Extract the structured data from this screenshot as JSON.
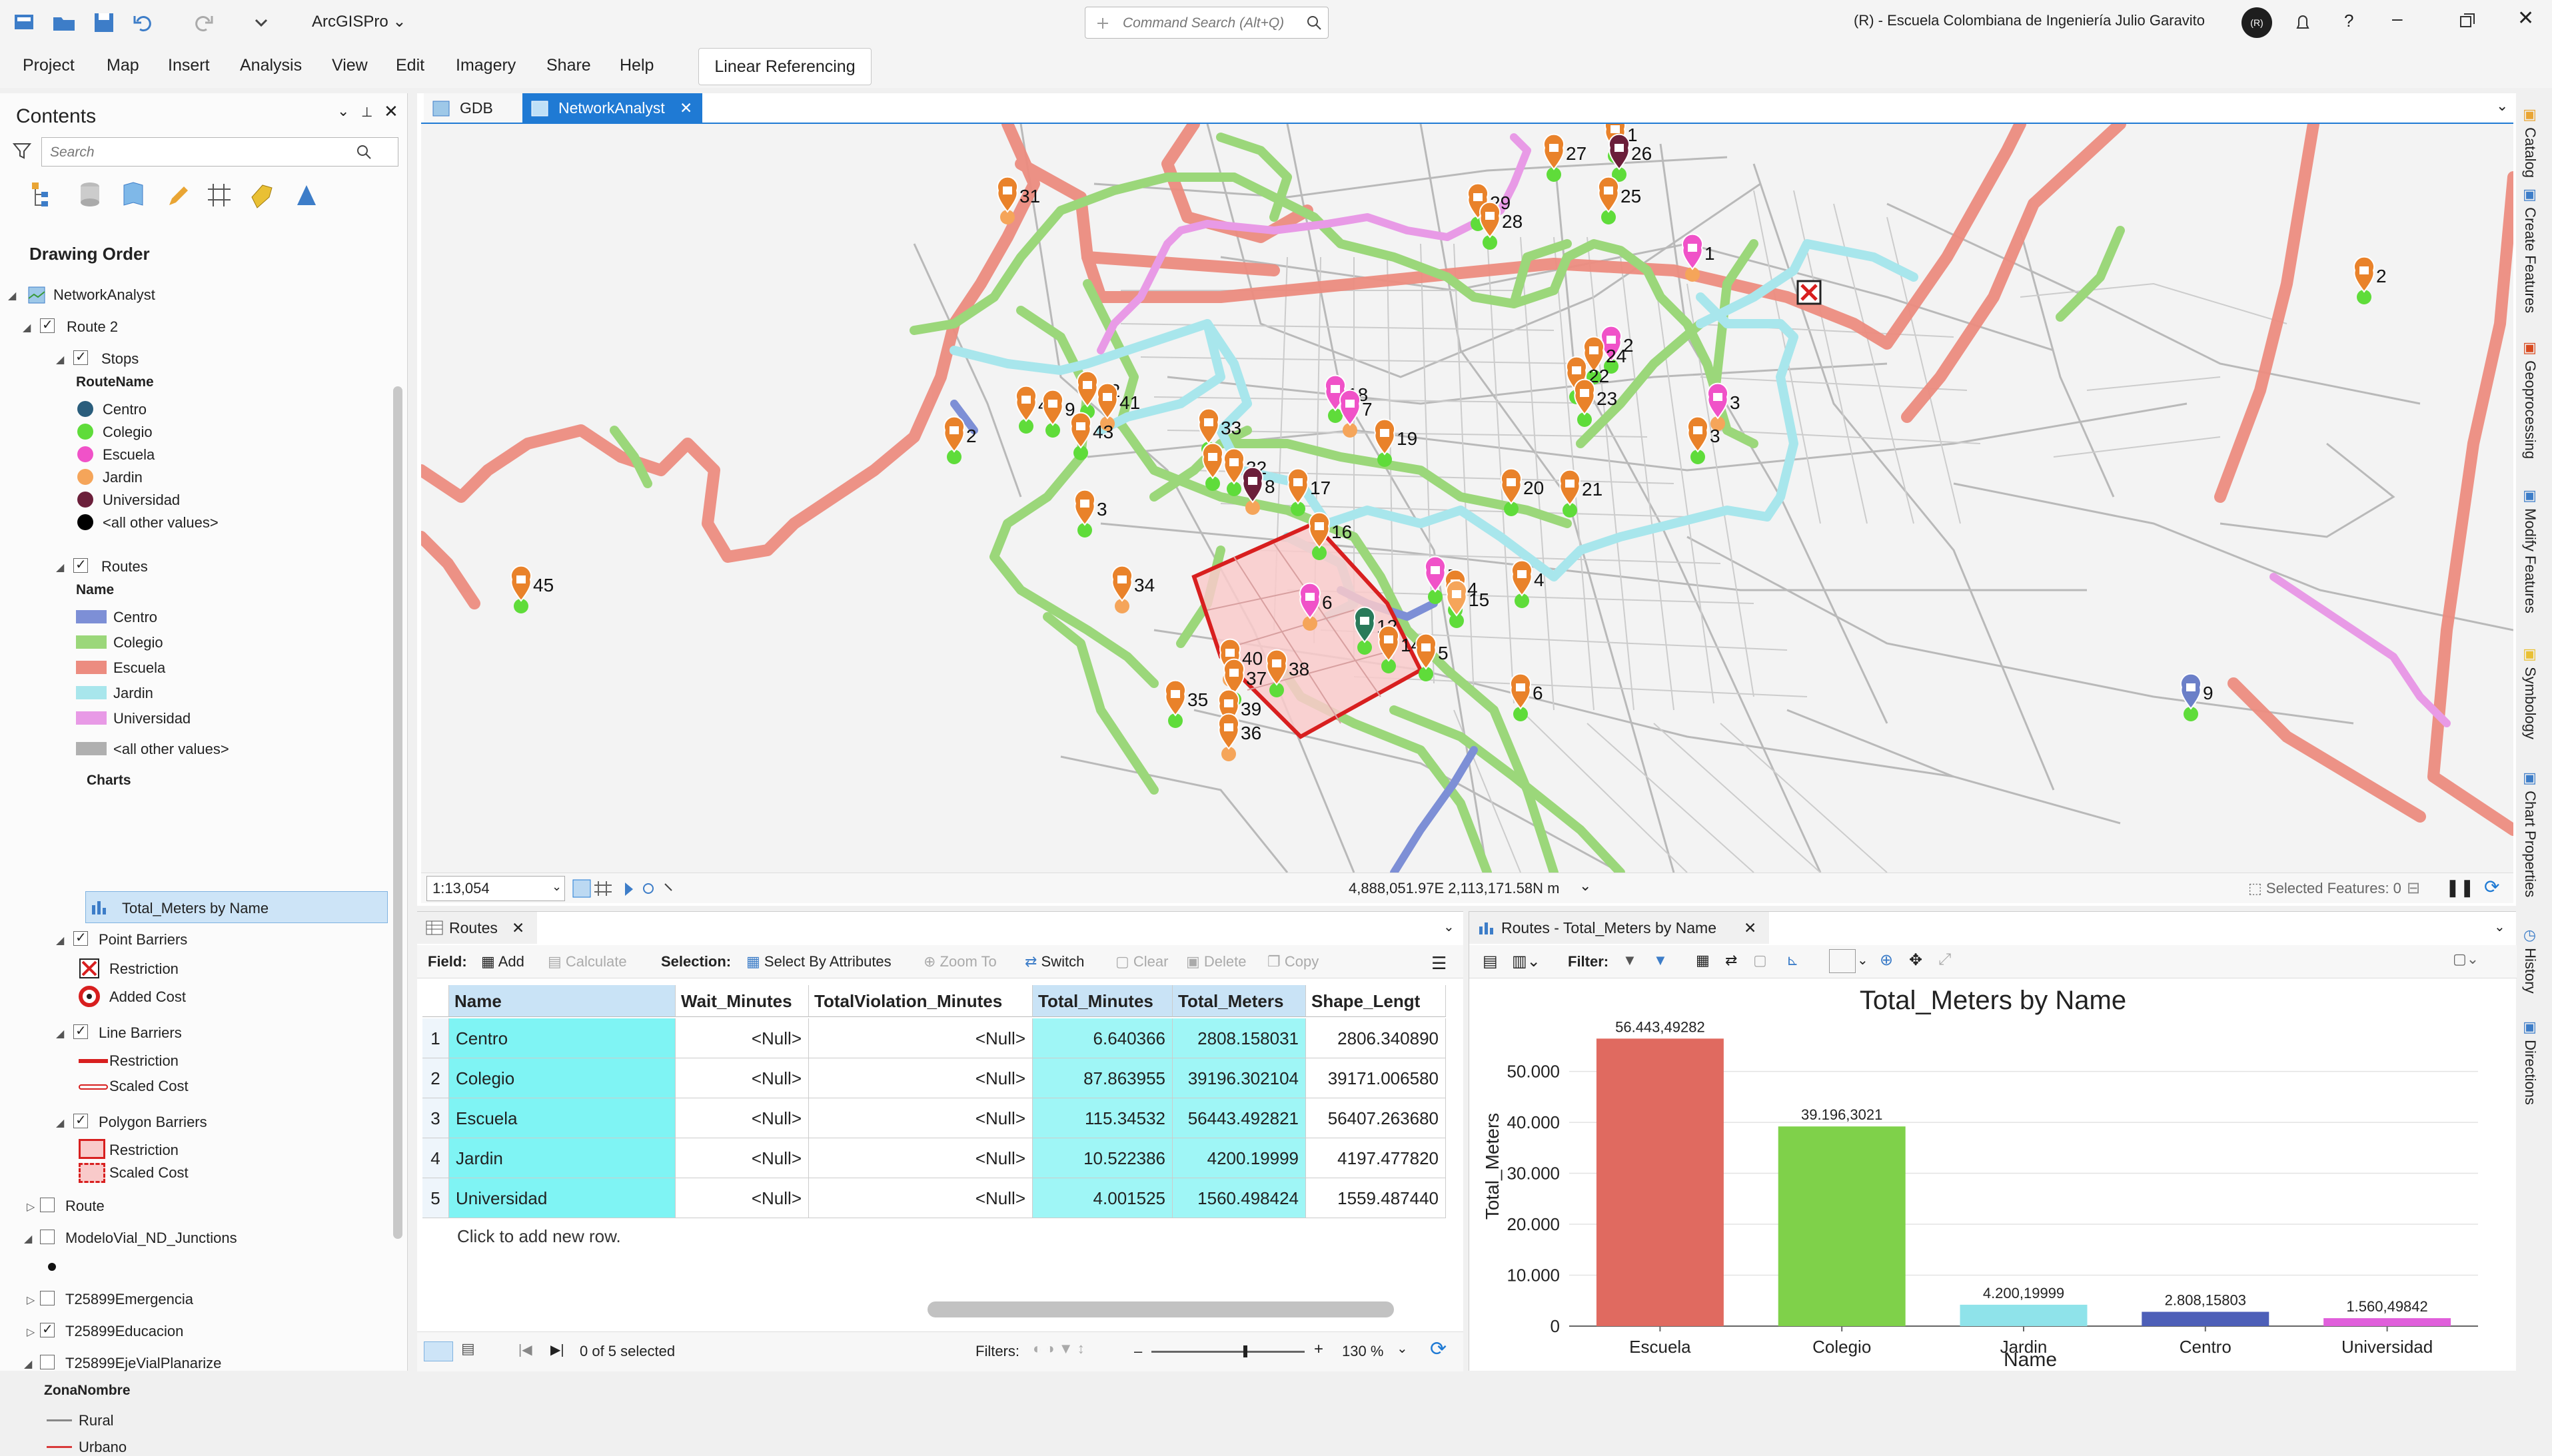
{
  "app": {
    "name": "ArcGISPro",
    "command_search_placeholder": "Command Search (Alt+Q)",
    "user": "(R) - Escuela Colombiana de Ingeniería Julio Garavito",
    "avatar": "(R)"
  },
  "menu": [
    "Project",
    "Map",
    "Insert",
    "Analysis",
    "View",
    "Edit",
    "Imagery",
    "Share",
    "Help"
  ],
  "contextual_tab": "Linear Referencing",
  "contents": {
    "title": "Contents",
    "search_placeholder": "Search",
    "drawing_order": "Drawing Order",
    "map_name": "NetworkAnalyst",
    "layers": {
      "route2": "Route 2",
      "stops": "Stops",
      "stops_field": "RouteName",
      "stops_legend": [
        {
          "label": "Centro",
          "color": "#2a5d7c"
        },
        {
          "label": "Colegio",
          "color": "#5fdc3a"
        },
        {
          "label": "Escuela",
          "color": "#f052c8"
        },
        {
          "label": "Jardin",
          "color": "#f5a55a"
        },
        {
          "label": "Universidad",
          "color": "#6b1f3a"
        },
        {
          "label": "<all other values>",
          "color": "#000000"
        }
      ],
      "routes": "Routes",
      "routes_field": "Name",
      "routes_legend": [
        {
          "label": "Centro",
          "color": "#7d8fd6"
        },
        {
          "label": "Colegio",
          "color": "#9bd77a"
        },
        {
          "label": "Escuela",
          "color": "#ec8c80"
        },
        {
          "label": "Jardin",
          "color": "#a8e6ec"
        },
        {
          "label": "Universidad",
          "color": "#e89ae6"
        },
        {
          "label": "<all other values>",
          "color": "#b0b0b0"
        }
      ],
      "charts": "Charts",
      "chart_item": "Total_Meters by Name",
      "point_barriers": "Point Barriers",
      "pb_items": [
        "Restriction",
        "Added Cost"
      ],
      "line_barriers": "Line Barriers",
      "lb_items": [
        "Restriction",
        "Scaled Cost"
      ],
      "polygon_barriers": "Polygon Barriers",
      "pgb_items": [
        "Restriction",
        "Scaled Cost"
      ],
      "route": "Route",
      "junctions": "ModeloVial_ND_Junctions",
      "emergencia": "T25899Emergencia",
      "educacion": "T25899Educacion",
      "ejevial": "T25899EjeVialPlanarize",
      "zona_field": "ZonaNombre",
      "zona_items": [
        "Rural",
        "Urbano"
      ]
    }
  },
  "tabs": {
    "gdb": "GDB",
    "network": "NetworkAnalyst"
  },
  "map": {
    "scale": "1:13,054",
    "coords": "4,888,051.97E 2,113,171.58N m",
    "selected_features": "Selected Features: 0",
    "stop_labels": [
      "1",
      "26",
      "31",
      "27",
      "25",
      "29",
      "28",
      "1",
      "2",
      "24",
      "22",
      "23",
      "3",
      "3",
      "2",
      "3",
      "42",
      "41",
      "44",
      "9",
      "43",
      "18",
      "7",
      "19",
      "33",
      "2",
      "32",
      "8",
      "17",
      "16",
      "20",
      "21",
      "34",
      "5",
      "4",
      "4",
      "15",
      "6",
      "12",
      "14",
      "5",
      "45",
      "40",
      "37",
      "38",
      "35",
      "39",
      "36",
      "6",
      "9",
      "2"
    ]
  },
  "table": {
    "tab": "Routes",
    "toolbar": {
      "field": "Field:",
      "add": "Add",
      "calculate": "Calculate",
      "selection": "Selection:",
      "select_by_attr": "Select By Attributes",
      "zoom_to": "Zoom To",
      "switch": "Switch",
      "clear": "Clear",
      "delete": "Delete",
      "copy": "Copy"
    },
    "columns": [
      "Name",
      "Wait_Minutes",
      "TotalViolation_Minutes",
      "Total_Minutes",
      "Total_Meters",
      "Shape_Lengt"
    ],
    "rows": [
      [
        "1",
        "Centro",
        "<Null>",
        "<Null>",
        "6.640366",
        "2808.158031",
        "2806.340890"
      ],
      [
        "2",
        "Colegio",
        "<Null>",
        "<Null>",
        "87.863955",
        "39196.302104",
        "39171.006580"
      ],
      [
        "3",
        "Escuela",
        "<Null>",
        "<Null>",
        "115.34532",
        "56443.492821",
        "56407.263680"
      ],
      [
        "4",
        "Jardin",
        "<Null>",
        "<Null>",
        "10.522386",
        "4200.19999",
        "4197.477820"
      ],
      [
        "5",
        "Universidad",
        "<Null>",
        "<Null>",
        "4.001525",
        "1560.498424",
        "1559.487440"
      ]
    ],
    "add_row": "Click to add new row.",
    "status": "0 of 5 selected",
    "filters": "Filters:",
    "zoom": "130 %"
  },
  "chart": {
    "tab": "Routes - Total_Meters by Name",
    "filter": "Filter:"
  },
  "chart_data": {
    "type": "bar",
    "title": "Total_Meters by Name",
    "xlabel": "Name",
    "ylabel": "Total_Meters",
    "categories": [
      "Escuela",
      "Colegio",
      "Jardin",
      "Centro",
      "Universidad"
    ],
    "values": [
      56443.49282,
      39196.3021,
      4200.19999,
      2808.15803,
      1560.49842
    ],
    "data_labels": [
      "56.443,49282",
      "39.196,3021",
      "4.200,19999",
      "2.808,15803",
      "1.560,49842"
    ],
    "colors": [
      "#e06a60",
      "#7fd14a",
      "#8fe3ea",
      "#4d5fb8",
      "#e05fdb"
    ],
    "yticks": [
      "0",
      "10.000",
      "20.000",
      "30.000",
      "40.000",
      "50.000"
    ],
    "ytick_values": [
      0,
      10000,
      20000,
      30000,
      40000,
      50000
    ],
    "ylim": [
      0,
      60000
    ],
    "grid": true
  },
  "side_tabs": [
    "Catalog",
    "Create Features",
    "Geoprocessing",
    "Modify Features",
    "Symbology",
    "Chart Properties",
    "History",
    "Directions"
  ]
}
